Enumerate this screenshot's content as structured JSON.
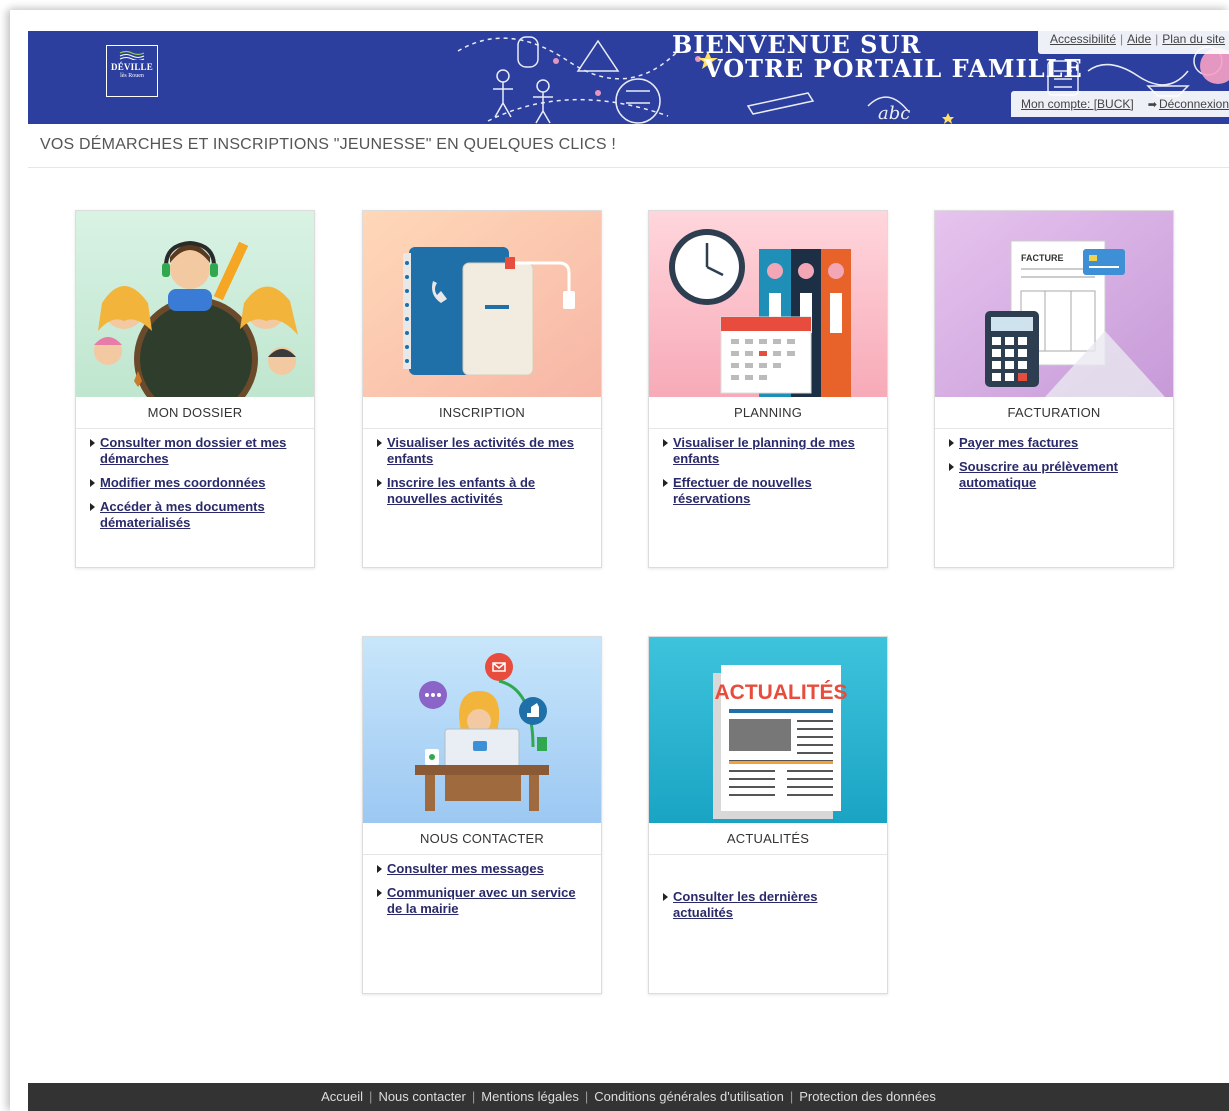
{
  "header": {
    "logo": {
      "line1": "DÉVILLE",
      "line2": "lès Rouen"
    },
    "welcome_line1": "Bienvenue sur",
    "welcome_line2": "votre portail famille",
    "top_links": [
      "Accessibilité",
      "Aide",
      "Plan du site"
    ],
    "account_label": "Mon compte: [BUCK]",
    "logout_label": "Déconnexion",
    "brand_color": "#2c3f9e"
  },
  "subtitle": "VOS DÉMARCHES ET INSCRIPTIONS \"JEUNESSE\" EN QUELQUES CLICS !",
  "cards": [
    {
      "title": "MON DOSSIER",
      "links": [
        "Consulter mon dossier et mes démarches",
        "Modifier mes coordonnées",
        "Accéder à mes documents dématerialisés"
      ]
    },
    {
      "title": "INSCRIPTION",
      "links": [
        "Visualiser les activités de mes enfants",
        "Inscrire les enfants à de nouvelles activités"
      ]
    },
    {
      "title": "PLANNING",
      "links": [
        "Visualiser le planning de mes enfants",
        "Effectuer de nouvelles réservations"
      ]
    },
    {
      "title": "FACTURATION",
      "links": [
        "Payer mes factures",
        "Souscrire au prélèvement automatique"
      ]
    },
    {
      "title": "NOUS CONTACTER",
      "links": [
        "Consulter mes messages",
        "Communiquer avec un service de la mairie"
      ]
    },
    {
      "title": "ACTUALITÉS",
      "image_text": "ACTUALITÉS",
      "links": [
        "Consulter les dernières actualités"
      ]
    }
  ],
  "facture_label": "FACTURE",
  "footer": {
    "links": [
      "Accueil",
      "Nous contacter",
      "Mentions légales",
      "Conditions générales d'utilisation",
      "Protection des données"
    ]
  }
}
